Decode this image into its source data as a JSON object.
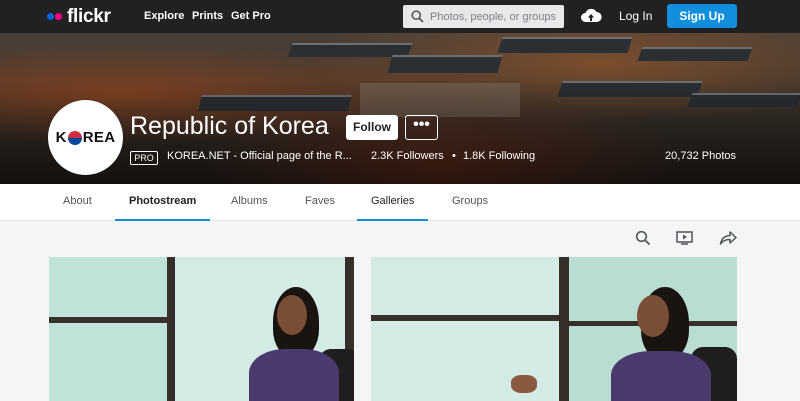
{
  "nav": {
    "logo": "flickr",
    "links": [
      "Explore",
      "Prints",
      "Get Pro"
    ],
    "search_placeholder": "Photos, people, or groups",
    "login": "Log In",
    "signup": "Sign Up",
    "colors": {
      "background": "#212124",
      "signup": "#128fdc",
      "dot_blue": "#0063dc",
      "dot_pink": "#ff0084"
    }
  },
  "profile": {
    "avatar_text_left": "K",
    "avatar_text_right": "REA",
    "name": "Republic of Korea",
    "follow": "Follow",
    "more": "•••",
    "badge": "PRO",
    "description": "KOREA.NET - Official page of the R...",
    "followers": "2.3K Followers",
    "bullet": "•",
    "following": "1.8K Following",
    "photos": "20,732 Photos"
  },
  "tabs": [
    {
      "label": "About"
    },
    {
      "label": "Photostream"
    },
    {
      "label": "Albums"
    },
    {
      "label": "Faves"
    },
    {
      "label": "Galleries"
    },
    {
      "label": "Groups"
    }
  ],
  "toolbar": {
    "icons": [
      "search-icon",
      "slideshow-icon",
      "share-icon"
    ]
  }
}
